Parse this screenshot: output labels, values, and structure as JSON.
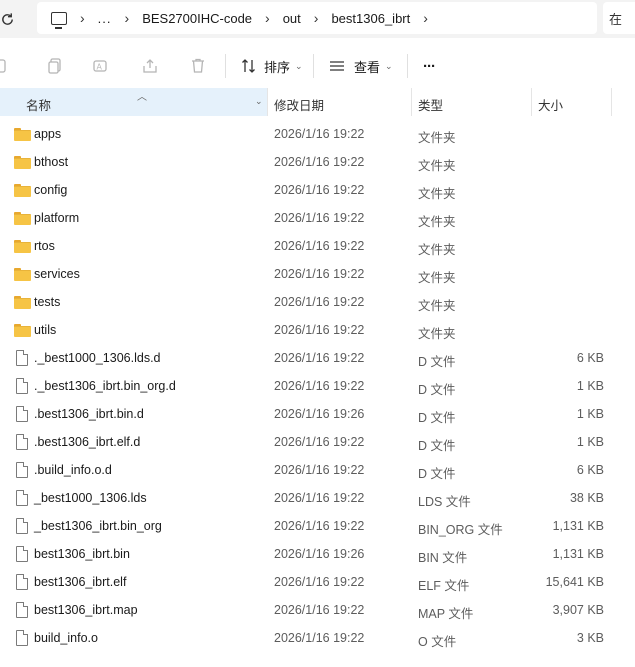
{
  "address_bar": {
    "overflow": "...",
    "crumbs": [
      "BES2700IHC-code",
      "out",
      "best1306_ibrt"
    ],
    "search_partial": "在"
  },
  "toolbar": {
    "sort_label": "排序",
    "view_label": "查看",
    "more_label": "···"
  },
  "columns": {
    "name": "名称",
    "date": "修改日期",
    "type": "类型",
    "size": "大小"
  },
  "files": [
    {
      "name": "apps",
      "date": "2026/1/16 19:22",
      "type": "文件夹",
      "size": "",
      "kind": "folder"
    },
    {
      "name": "bthost",
      "date": "2026/1/16 19:22",
      "type": "文件夹",
      "size": "",
      "kind": "folder"
    },
    {
      "name": "config",
      "date": "2026/1/16 19:22",
      "type": "文件夹",
      "size": "",
      "kind": "folder"
    },
    {
      "name": "platform",
      "date": "2026/1/16 19:22",
      "type": "文件夹",
      "size": "",
      "kind": "folder"
    },
    {
      "name": "rtos",
      "date": "2026/1/16 19:22",
      "type": "文件夹",
      "size": "",
      "kind": "folder"
    },
    {
      "name": "services",
      "date": "2026/1/16 19:22",
      "type": "文件夹",
      "size": "",
      "kind": "folder"
    },
    {
      "name": "tests",
      "date": "2026/1/16 19:22",
      "type": "文件夹",
      "size": "",
      "kind": "folder"
    },
    {
      "name": "utils",
      "date": "2026/1/16 19:22",
      "type": "文件夹",
      "size": "",
      "kind": "folder"
    },
    {
      "name": "._best1000_1306.lds.d",
      "date": "2026/1/16 19:22",
      "type": "D 文件",
      "size": "6 KB",
      "kind": "file"
    },
    {
      "name": "._best1306_ibrt.bin_org.d",
      "date": "2026/1/16 19:22",
      "type": "D 文件",
      "size": "1 KB",
      "kind": "file"
    },
    {
      "name": ".best1306_ibrt.bin.d",
      "date": "2026/1/16 19:26",
      "type": "D 文件",
      "size": "1 KB",
      "kind": "file"
    },
    {
      "name": ".best1306_ibrt.elf.d",
      "date": "2026/1/16 19:22",
      "type": "D 文件",
      "size": "1 KB",
      "kind": "file"
    },
    {
      "name": ".build_info.o.d",
      "date": "2026/1/16 19:22",
      "type": "D 文件",
      "size": "6 KB",
      "kind": "file"
    },
    {
      "name": "_best1000_1306.lds",
      "date": "2026/1/16 19:22",
      "type": "LDS 文件",
      "size": "38 KB",
      "kind": "file"
    },
    {
      "name": "_best1306_ibrt.bin_org",
      "date": "2026/1/16 19:22",
      "type": "BIN_ORG 文件",
      "size": "1,131 KB",
      "kind": "file"
    },
    {
      "name": "best1306_ibrt.bin",
      "date": "2026/1/16 19:26",
      "type": "BIN 文件",
      "size": "1,131 KB",
      "kind": "file"
    },
    {
      "name": "best1306_ibrt.elf",
      "date": "2026/1/16 19:22",
      "type": "ELF 文件",
      "size": "15,641 KB",
      "kind": "file"
    },
    {
      "name": "best1306_ibrt.map",
      "date": "2026/1/16 19:22",
      "type": "MAP 文件",
      "size": "3,907 KB",
      "kind": "file"
    },
    {
      "name": "build_info.o",
      "date": "2026/1/16 19:22",
      "type": "O 文件",
      "size": "3 KB",
      "kind": "file"
    }
  ],
  "colors": {
    "header_highlight": "#e5f1fb",
    "folder": "#f6c445",
    "secondary_text": "#5c5c5c"
  }
}
